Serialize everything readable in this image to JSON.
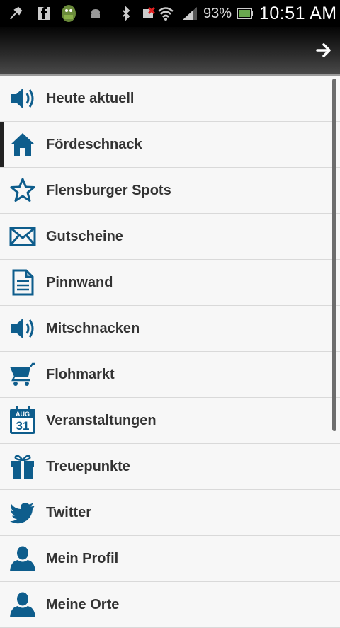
{
  "status": {
    "battery_pct": "93%",
    "time": "10:51 AM"
  },
  "menu": {
    "items": [
      {
        "label": "Heute aktuell",
        "icon": "speaker-icon"
      },
      {
        "label": "Fördeschnack",
        "icon": "home-icon"
      },
      {
        "label": "Flensburger Spots",
        "icon": "star-icon"
      },
      {
        "label": "Gutscheine",
        "icon": "envelope-icon"
      },
      {
        "label": "Pinnwand",
        "icon": "document-icon"
      },
      {
        "label": "Mitschnacken",
        "icon": "speaker-icon"
      },
      {
        "label": "Flohmarkt",
        "icon": "cart-icon"
      },
      {
        "label": "Veranstaltungen",
        "icon": "calendar-icon",
        "cal_month": "AUG",
        "cal_day": "31"
      },
      {
        "label": "Treuepunkte",
        "icon": "gift-icon"
      },
      {
        "label": "Twitter",
        "icon": "twitter-bird-icon"
      },
      {
        "label": "Mein Profil",
        "icon": "person-icon"
      },
      {
        "label": "Meine Orte",
        "icon": "person-icon"
      }
    ]
  },
  "colors": {
    "accent": "#0e5d8c",
    "statusbar": "#000000"
  }
}
